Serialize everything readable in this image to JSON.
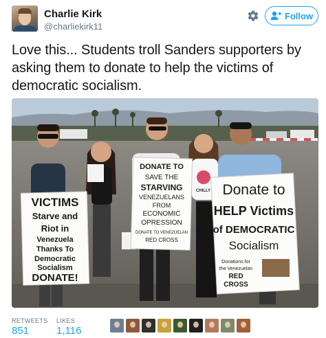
{
  "header": {
    "display_name": "Charlie Kirk",
    "handle": "@charliekirk11",
    "follow_label": "Follow"
  },
  "tweet": {
    "text": "Love this... Students troll Sanders supporters by asking them to donate to help the victims of democratic socialism."
  },
  "photo": {
    "sign_left": [
      "VICTIMS",
      "Starve and",
      "Riot in",
      "Venezuela",
      "Thanks To",
      "Democratic",
      "Socialism",
      "DONATE!"
    ],
    "sign_middle": [
      "DONATE TO",
      "SAVE THE",
      "STARVING",
      "VENEZUELANS",
      "FROM",
      "ECONOMIC",
      "OPRESSION",
      "DONATE TO VENEZUELAN",
      "RED CROSS"
    ],
    "sign_right": [
      "Donate to",
      "HELP Victims",
      "of DEMOCRATIC",
      "Socialism",
      "Donations for",
      "the Venezuelan",
      "RED",
      "CROSS"
    ],
    "shirt_text": "CHILLY"
  },
  "stats": {
    "retweets_label": "RETWEETS",
    "retweets_value": "851",
    "likes_label": "LIKES",
    "likes_value": "1,116"
  },
  "likers": [
    {
      "color": "#6a7f95"
    },
    {
      "color": "#8c5a3c"
    },
    {
      "color": "#2f2f2f"
    },
    {
      "color": "#c9a13b"
    },
    {
      "color": "#3c5a2e"
    },
    {
      "color": "#1e1e1e"
    },
    {
      "color": "#b07a5a"
    },
    {
      "color": "#7c8a6a"
    },
    {
      "color": "#a0603a"
    }
  ],
  "colors": {
    "accent": "#1da1f2",
    "text": "#14171a",
    "muted": "#657786"
  }
}
